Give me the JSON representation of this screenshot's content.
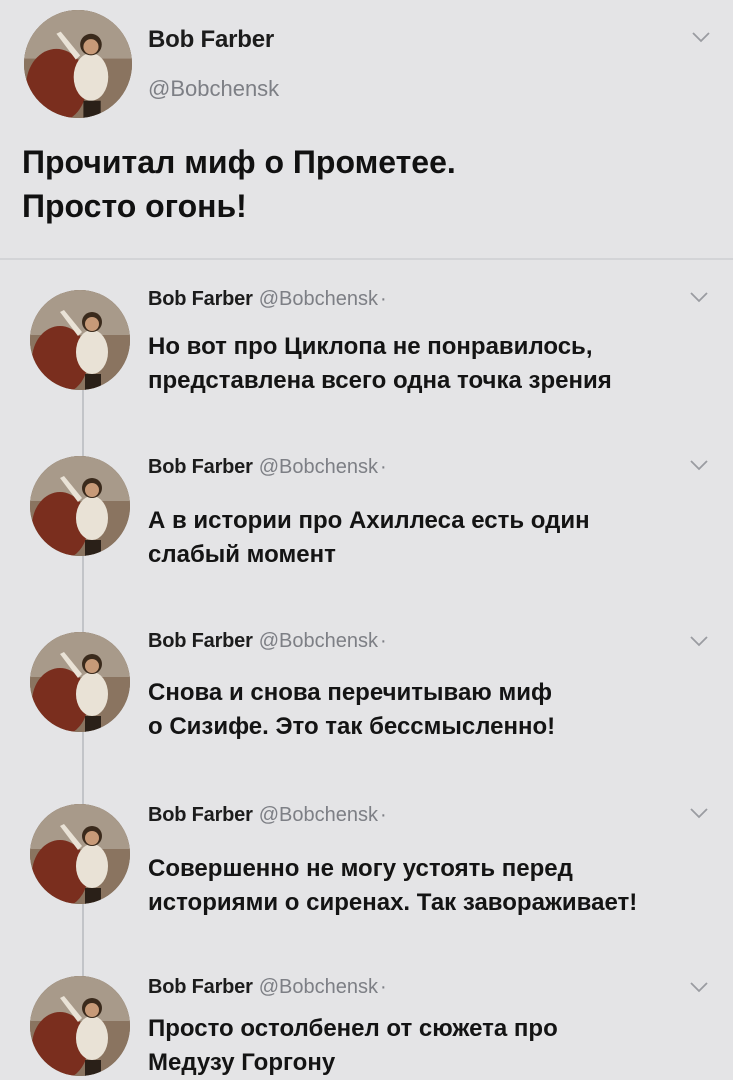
{
  "colors": {
    "background": "#e4e4e6",
    "text": "#141414",
    "handle": "#7d7f85",
    "thread_line": "#c2c4c8"
  },
  "main_tweet": {
    "author_name": "Bob Farber",
    "author_handle": "@Bobchensk",
    "avatar_icon": "avatar-image",
    "menu_icon": "chevron-down-icon",
    "text_lines": [
      "Прочитал миф о Прометее.",
      "Просто огонь!"
    ]
  },
  "replies": [
    {
      "author_name": "Bob Farber",
      "author_handle": "@Bobchensk",
      "separator": "·",
      "text_lines": [
        "Но вот про Циклопа не понравилось,",
        "представлена всего одна точка зрения"
      ]
    },
    {
      "author_name": "Bob Farber",
      "author_handle": "@Bobchensk",
      "separator": "·",
      "text_lines": [
        "А в истории про Ахиллеса есть один",
        "слабый момент"
      ]
    },
    {
      "author_name": "Bob Farber",
      "author_handle": "@Bobchensk",
      "separator": "·",
      "text_lines": [
        "Снова и снова перечитываю миф",
        "о Сизифе. Это так бессмысленно!"
      ]
    },
    {
      "author_name": "Bob Farber",
      "author_handle": "@Bobchensk",
      "separator": "·",
      "text_lines": [
        "Совершенно не могу устоять перед",
        "историями о сиренах. Так завораживает!"
      ]
    },
    {
      "author_name": "Bob Farber",
      "author_handle": "@Bobchensk",
      "separator": "·",
      "text_lines": [
        "Просто остолбенел от сюжета про",
        "Медузу Горгону"
      ]
    }
  ]
}
